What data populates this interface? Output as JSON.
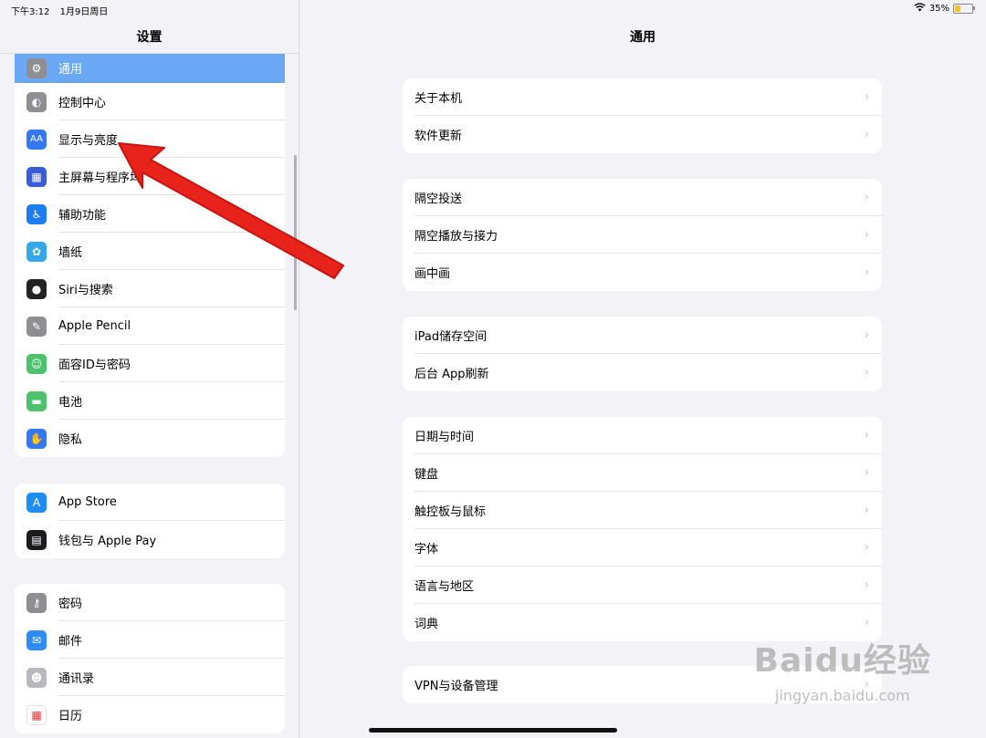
{
  "status_bar": {
    "time": "下午3:12",
    "date": "1月9日周日",
    "battery": "35%",
    "battery_level": 0.35
  },
  "sidebar": {
    "title": "设置",
    "groups": [
      {
        "items": [
          {
            "label": "通用",
            "icon": "gear-icon",
            "color": "#8e8e93",
            "selected": true
          },
          {
            "label": "控制中心",
            "icon": "switches-icon",
            "color": "#8e8e93"
          },
          {
            "label": "显示与亮度",
            "icon": "text-size-icon",
            "glyph": "AA",
            "color": "#3478f6"
          },
          {
            "label": "主屏幕与程序坞",
            "icon": "grid-icon",
            "color": "#3a5bd9"
          },
          {
            "label": "辅助功能",
            "icon": "accessibility-icon",
            "color": "#1e7cf2"
          },
          {
            "label": "墙纸",
            "icon": "flower-icon",
            "color": "#34a7e8"
          },
          {
            "label": "Siri与搜索",
            "icon": "siri-icon",
            "color": "#222222"
          },
          {
            "label": "Apple Pencil",
            "icon": "pencil-icon",
            "color": "#8e8e93"
          },
          {
            "label": "面容ID与密码",
            "icon": "face-id-icon",
            "color": "#4cc36b"
          },
          {
            "label": "电池",
            "icon": "battery-icon",
            "color": "#4cc36b"
          },
          {
            "label": "隐私",
            "icon": "hand-icon",
            "color": "#3478f6"
          }
        ]
      },
      {
        "items": [
          {
            "label": "App Store",
            "icon": "app-store-icon",
            "color": "#1e8cf4"
          },
          {
            "label": "钱包与 Apple Pay",
            "icon": "wallet-icon",
            "color": "#1c1c1e"
          }
        ]
      },
      {
        "items": [
          {
            "label": "密码",
            "icon": "key-icon",
            "color": "#8e8e93"
          },
          {
            "label": "邮件",
            "icon": "mail-icon",
            "color": "#2f8cf5"
          },
          {
            "label": "通讯录",
            "icon": "contacts-icon",
            "color": "#b9b9bd"
          },
          {
            "label": "日历",
            "icon": "calendar-icon",
            "color": "#ffffff"
          }
        ]
      }
    ]
  },
  "main": {
    "title": "通用",
    "groups": [
      [
        "关于本机",
        "软件更新"
      ],
      [
        "隔空投送",
        "隔空播放与接力",
        "画中画"
      ],
      [
        "iPad储存空间",
        "后台 App刷新"
      ],
      [
        "日期与时间",
        "键盘",
        "触控板与鼠标",
        "字体",
        "语言与地区",
        "词典"
      ],
      [
        "VPN与设备管理"
      ]
    ]
  },
  "watermark": {
    "brand": "Baidu经验",
    "url": "jingyan.baidu.com"
  }
}
